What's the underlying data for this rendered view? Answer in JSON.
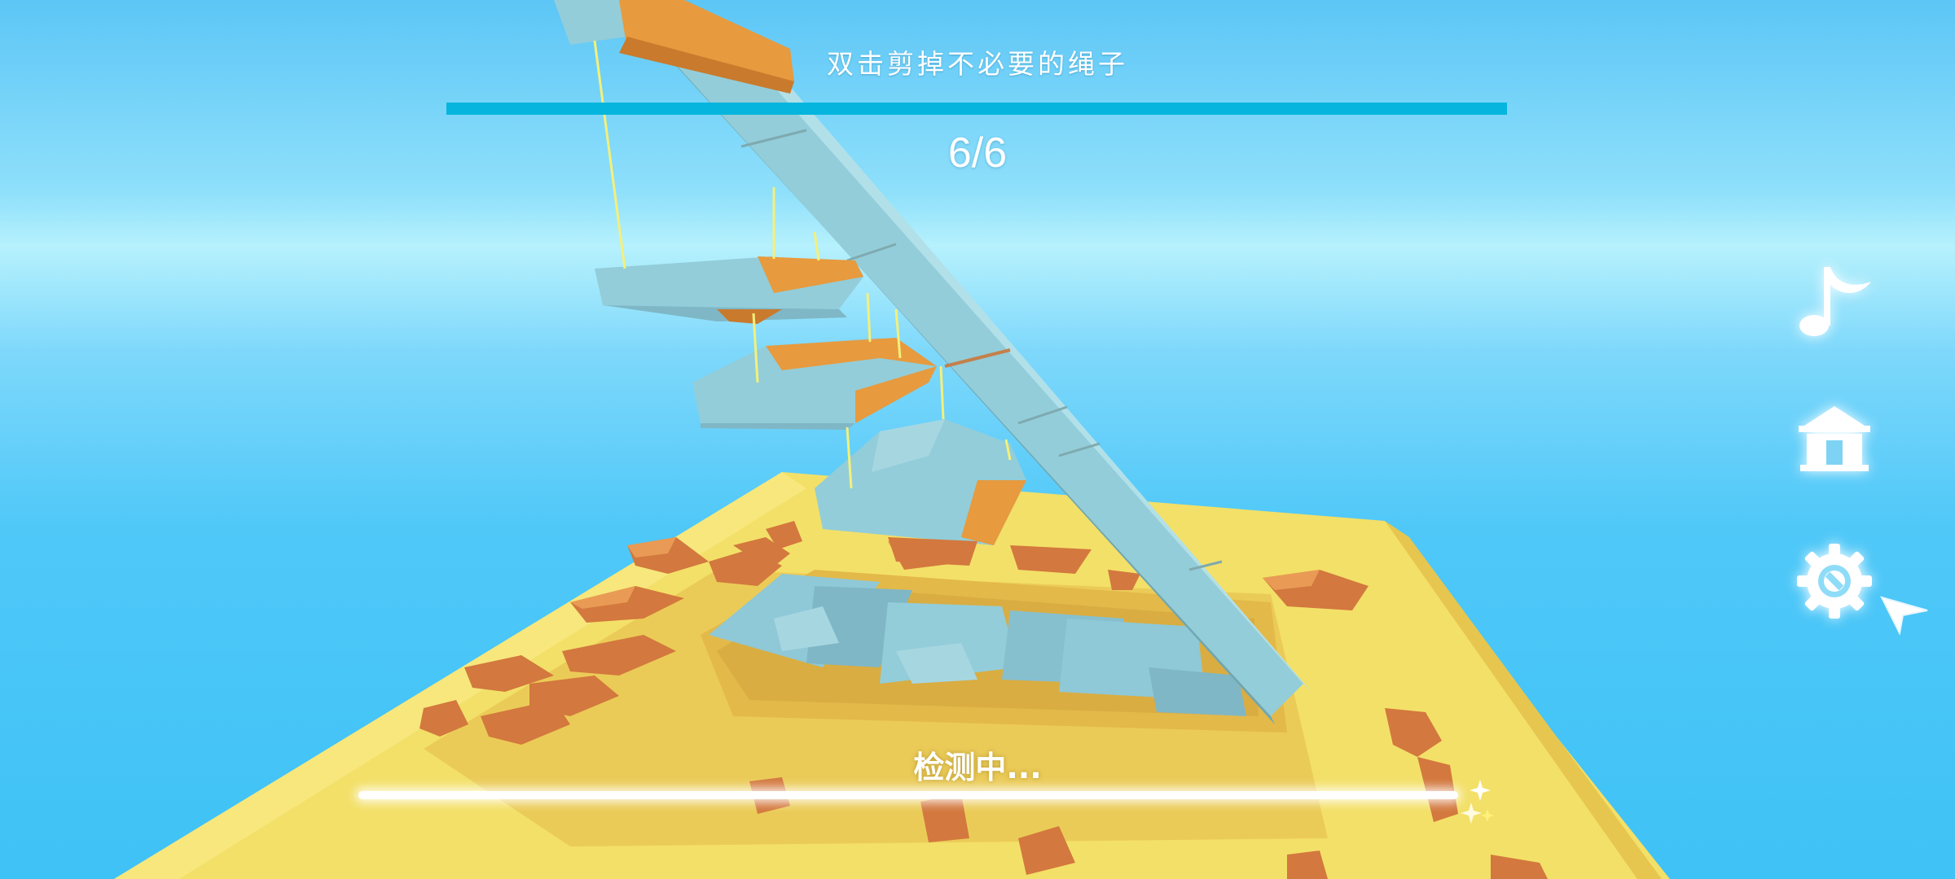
{
  "hud": {
    "instruction": "双击剪掉不必要的绳子",
    "level_counter": "6/6",
    "level_progress": 1.0,
    "check_status": "检测中...",
    "check_progress": 1.0
  },
  "side_menu": {
    "music_icon": "music-note-icon",
    "home_icon": "home-icon",
    "settings_icon": "gear-icon"
  },
  "colors": {
    "sky_top": "#5cc6f6",
    "sky_band": "#b6f1fd",
    "sky_bottom": "#3fc2f6",
    "ground": "#f3e068",
    "ground_shade": "#e8c24e",
    "block_blue": "#93cdd9",
    "block_orange": "#e79a3e",
    "rock": "#d3783e",
    "rope": "#f4f07a",
    "progress_fill": "#05b5dd"
  }
}
